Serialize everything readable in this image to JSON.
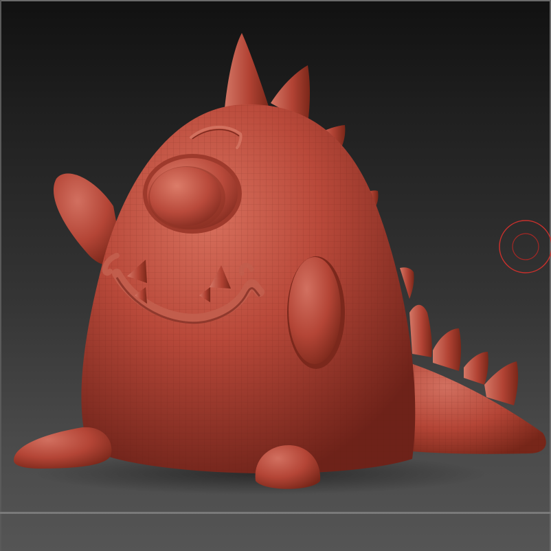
{
  "viewport": {
    "background_top": "#111111",
    "background_bottom": "#555555"
  },
  "model": {
    "base_color": "#b8483a",
    "highlight_color": "#d06a58",
    "shadow_color": "#6e2219",
    "wireframe_color": "#8e3327"
  },
  "brush_cursor": {
    "color": "#c8302c"
  },
  "icons": [
    "brush-cursor-icon"
  ]
}
